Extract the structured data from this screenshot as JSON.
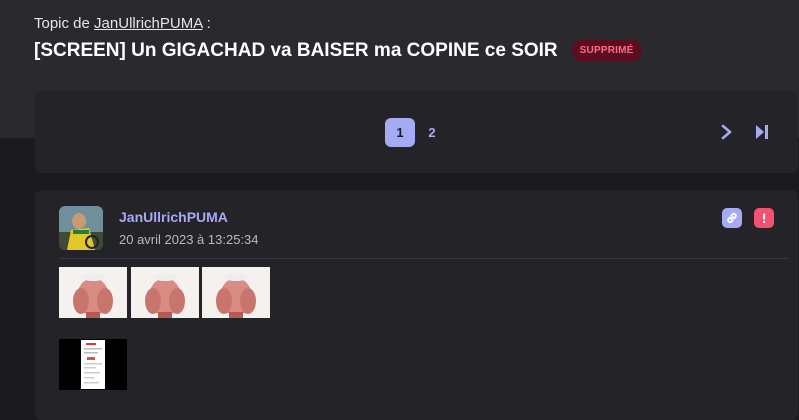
{
  "topic": {
    "prefix": "Topic de",
    "author": "JanUllrichPUMA",
    "suffix": ":",
    "title": "[SCREEN] Un GIGACHAD va BAISER ma COPINE ce SOIR",
    "status_badge": "SUPPRIMÉ"
  },
  "pagination": {
    "pages": [
      "1",
      "2"
    ],
    "current_page": "1",
    "next_icon": "chevron-right-icon",
    "last_icon": "skip-to-last-icon"
  },
  "post": {
    "author": "JanUllrichPUMA",
    "date": "20 avril 2023 à 13:25:34",
    "actions": [
      "link-icon",
      "report-icon"
    ],
    "images": [
      "facepalm-image",
      "facepalm-image",
      "facepalm-image"
    ],
    "attachment": "document-screenshot-image"
  },
  "colors": {
    "accent": "#a5aaf5",
    "badge_bg": "#5a0e1f",
    "badge_text": "#ff6b8a",
    "report": "#f0526f"
  }
}
